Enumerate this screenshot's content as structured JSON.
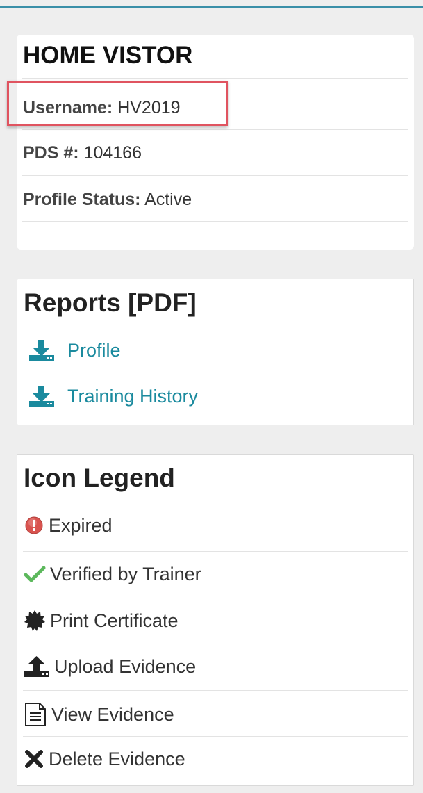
{
  "profile": {
    "title": "HOME VISTOR",
    "fields": [
      {
        "label": "Username:",
        "value": "HV2019"
      },
      {
        "label": "PDS #:",
        "value": "104166"
      },
      {
        "label": "Profile Status:",
        "value": "Active"
      }
    ]
  },
  "reports": {
    "title": "Reports [PDF]",
    "links": [
      {
        "label": "Profile",
        "icon": "download-icon"
      },
      {
        "label": "Training History",
        "icon": "download-icon"
      }
    ]
  },
  "legend": {
    "title": "Icon Legend",
    "items": [
      {
        "label": "Expired",
        "icon": "exclamation-circle-icon"
      },
      {
        "label": "Verified by Trainer",
        "icon": "checkmark-icon"
      },
      {
        "label": "Print Certificate",
        "icon": "certificate-icon"
      },
      {
        "label": "Upload Evidence",
        "icon": "upload-icon"
      },
      {
        "label": "View Evidence",
        "icon": "document-icon"
      },
      {
        "label": "Delete Evidence",
        "icon": "x-icon"
      }
    ]
  },
  "colors": {
    "accent": "#1a8a9e",
    "highlight": "#e05460",
    "expired": "#d9534f",
    "verified": "#5cb85c"
  }
}
